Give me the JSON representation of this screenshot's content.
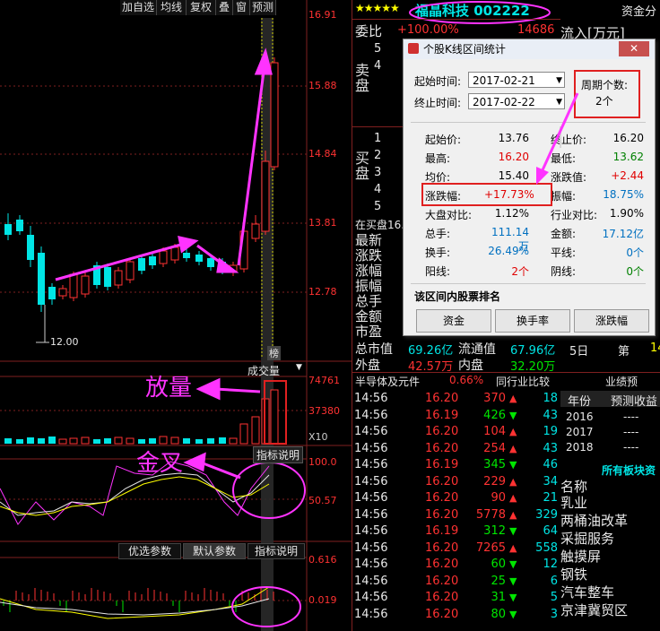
{
  "toolbar": {
    "buttons": [
      "加自选",
      "均线",
      "复权",
      "叠",
      "窗",
      "预测"
    ]
  },
  "price_axis": [
    "16.91",
    "15.88",
    "14.84",
    "13.81",
    "12.78"
  ],
  "low_marker": "12.00",
  "volume": {
    "label": "成交量",
    "axis_top": "74761",
    "axis_mid": "37380",
    "unit": "X10",
    "indicator_btn": "指标说明"
  },
  "kdj": {
    "axis_top": "100.0",
    "axis_mid": "50.57"
  },
  "macd": {
    "btn_opt": "优选参数",
    "btn_default": "默认参数",
    "btn_desc": "指标说明",
    "axis_top": "0.616",
    "axis_mid": "0.019"
  },
  "annotations": {
    "volume": "放量",
    "cross": "金叉",
    "sell": "榜"
  },
  "quote": {
    "stars": "★★★★★",
    "name": "福晶科技 002222",
    "weibi_label": "委比",
    "weibi_value": "+100.00%",
    "weicha_value": "14686",
    "fund_label": "资金分",
    "inflow_label": "流入[万元]",
    "sell_label": "卖盘",
    "buy_label": "买盘",
    "sell_levels": [
      "5",
      "4"
    ],
    "buy_levels": [
      "1",
      "2",
      "3",
      "4",
      "5"
    ],
    "buy_top": "在买盘16.",
    "stats": [
      "最新",
      "涨跌",
      "涨幅",
      "振幅",
      "总手",
      "金额",
      "市盈"
    ],
    "total_mv_label": "总市值",
    "total_mv": "69.26亿",
    "float_mv_label": "流通值",
    "float_mv": "67.96亿",
    "outer_label": "外盘",
    "outer": "42.57万",
    "inner_label": "内盘",
    "inner": "32.20万",
    "days": "5日",
    "rank_label": "第",
    "rank_value": "14",
    "sector": "半导体及元件",
    "sector_pct": "0.66%",
    "peer_compare": "同行业比较",
    "forecast_title": "业绩预",
    "forecast_cols": [
      "年份",
      "预测收益"
    ],
    "forecast_rows": [
      [
        "2016",
        "----"
      ],
      [
        "2017",
        "----"
      ],
      [
        "2018",
        "----"
      ]
    ],
    "concepts_title": "所有板块资",
    "concepts_header": "名称",
    "concepts": [
      "乳业",
      "两桶油改革",
      "采掘服务",
      "触摸屏",
      "钢铁",
      "汽车整车",
      "京津冀贸区"
    ]
  },
  "ticks": [
    {
      "time": "14:56",
      "price": "16.20",
      "vol": "370",
      "dir": "up",
      "n": "18"
    },
    {
      "time": "14:56",
      "price": "16.19",
      "vol": "426",
      "dir": "down",
      "n": "43"
    },
    {
      "time": "14:56",
      "price": "16.20",
      "vol": "104",
      "dir": "up",
      "n": "19"
    },
    {
      "time": "14:56",
      "price": "16.20",
      "vol": "254",
      "dir": "up",
      "n": "43"
    },
    {
      "time": "14:56",
      "price": "16.19",
      "vol": "345",
      "dir": "down",
      "n": "46"
    },
    {
      "time": "14:56",
      "price": "16.20",
      "vol": "229",
      "dir": "up",
      "n": "34"
    },
    {
      "time": "14:56",
      "price": "16.20",
      "vol": "90",
      "dir": "up",
      "n": "21"
    },
    {
      "time": "14:56",
      "price": "16.20",
      "vol": "5778",
      "dir": "up",
      "n": "329"
    },
    {
      "time": "14:56",
      "price": "16.19",
      "vol": "312",
      "dir": "down",
      "n": "64"
    },
    {
      "time": "14:56",
      "price": "16.20",
      "vol": "7265",
      "dir": "up",
      "n": "558"
    },
    {
      "time": "14:56",
      "price": "16.20",
      "vol": "60",
      "dir": "down",
      "n": "12"
    },
    {
      "time": "14:56",
      "price": "16.20",
      "vol": "25",
      "dir": "down",
      "n": "6"
    },
    {
      "time": "14:56",
      "price": "16.20",
      "vol": "31",
      "dir": "down",
      "n": "5"
    },
    {
      "time": "14:56",
      "price": "16.20",
      "vol": "80",
      "dir": "down",
      "n": "3"
    }
  ],
  "dialog": {
    "title": "个股K线区间统计",
    "close": "✕",
    "start_label": "起始时间:",
    "start_value": "2017-02-21",
    "end_label": "终止时间:",
    "end_value": "2017-02-22",
    "period_label": "周期个数:",
    "period_value": "2个",
    "rows": [
      {
        "l1": "起始价:",
        "v1": "13.76",
        "c1": "#000",
        "l2": "终止价:",
        "v2": "16.20",
        "c2": "#000"
      },
      {
        "l1": "最高:",
        "v1": "16.20",
        "c1": "#e00000",
        "l2": "最低:",
        "v2": "13.62",
        "c2": "#008000"
      },
      {
        "l1": "均价:",
        "v1": "15.40",
        "c1": "#000",
        "l2": "涨跌值:",
        "v2": "+2.44",
        "c2": "#e00000"
      },
      {
        "l1": "涨跌幅:",
        "v1": "+17.73%",
        "c1": "#e00000",
        "l2": "振幅:",
        "v2": "18.75%",
        "c2": "#0070c0"
      },
      {
        "l1": "大盘对比:",
        "v1": "1.12%",
        "c1": "#000",
        "l2": "行业对比:",
        "v2": "1.90%",
        "c2": "#000"
      },
      {
        "l1": "总手:",
        "v1": "111.14万",
        "c1": "#0070c0",
        "l2": "金额:",
        "v2": "17.12亿",
        "c2": "#0070c0"
      },
      {
        "l1": "换手:",
        "v1": "26.49%",
        "c1": "#0070c0",
        "l2": "平线:",
        "v2": "0个",
        "c2": "#0070c0"
      },
      {
        "l1": "阳线:",
        "v1": "2个",
        "c1": "#e00000",
        "l2": "阴线:",
        "v2": "0个",
        "c2": "#008000"
      }
    ],
    "rank_title": "该区间内股票排名",
    "btn_fund": "资金",
    "btn_turnover": "换手率",
    "btn_change": "涨跌幅"
  },
  "colors": {
    "up": "#ff3232",
    "down": "#00e5e5",
    "annotation": "#ff33ff",
    "highlight_box": "#e02020"
  }
}
